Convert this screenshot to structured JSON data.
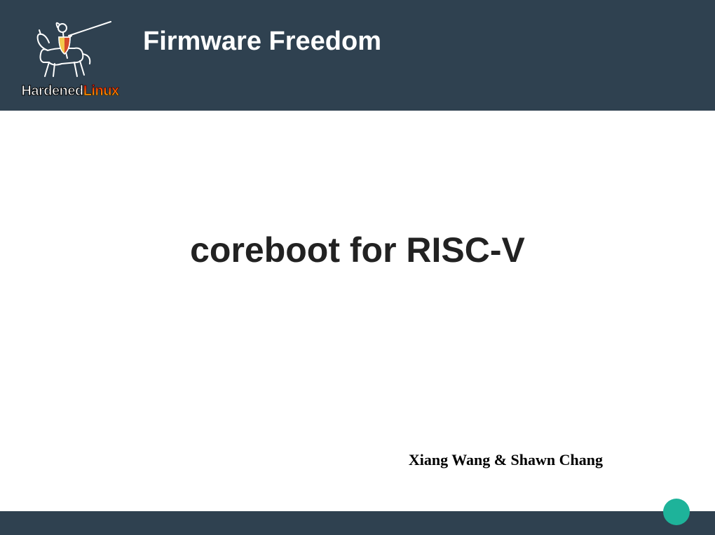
{
  "header": {
    "logo_text_1": "Hardened",
    "logo_text_2": "Linux",
    "tagline": "Firmware Freedom"
  },
  "slide": {
    "title": "coreboot for RISC-V",
    "authors": "Xiang Wang & Shawn Chang"
  },
  "colors": {
    "header_bg": "#2f4150",
    "accent_dot": "#1eb39a"
  }
}
